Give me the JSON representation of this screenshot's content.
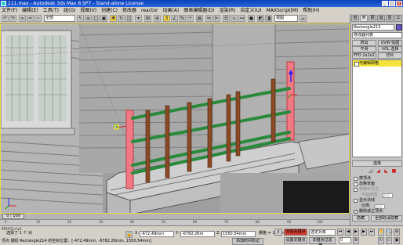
{
  "window": {
    "title": "111.max - Autodesk 3ds Max 8 SP7  -  Stand-alone License",
    "buttons": [
      "_",
      "□",
      "×"
    ]
  },
  "menu": [
    "文件(F)",
    "编辑(E)",
    "工具(T)",
    "组(G)",
    "视图(V)",
    "创建(C)",
    "修改器",
    "reactor",
    "动画(A)",
    "图表编辑器(D)",
    "渲染(R)",
    "自定义(U)",
    "MAXScript(M)",
    "帮助(H)"
  ],
  "toolbar": {
    "filter_select": "全部",
    "view_select": "视图"
  },
  "command_panel": {
    "tabs": [
      "创",
      "修",
      "层",
      "运",
      "显",
      "工"
    ],
    "object_name": "Rectangle213",
    "modifier_list": "修改器列表",
    "buttons_row1": [
      "挤出",
      "UVW 贴图"
    ],
    "buttons_row2": [
      "平滑",
      "VOL 选择"
    ],
    "buttons_row3": [
      "FFD 2x2x2",
      "切片"
    ],
    "stack_item": "可编辑网格",
    "rollout_title": "选择",
    "options": [
      {
        "label": "按顶点",
        "checked": false,
        "dim": false
      },
      {
        "label": "忽略背面",
        "checked": false,
        "dim": false
      },
      {
        "label": "忽略可见边",
        "checked": false,
        "dim": true
      },
      {
        "label": "平面阈值:",
        "checked": false,
        "dim": true,
        "value": "45.0"
      },
      {
        "label": "显示法线",
        "checked": false,
        "dim": false
      },
      {
        "label": "比例:",
        "checked": false,
        "dim": false,
        "value": "20.0"
      },
      {
        "label": "删除孤立顶点",
        "checked": true,
        "dim": false
      }
    ],
    "hide_buttons": [
      "隐藏",
      "全部取消隐藏"
    ],
    "named_selection": "命名选择:",
    "copy_paste": [
      "复制",
      "粘贴"
    ],
    "status": "选择了 24 个面"
  },
  "timeline": {
    "slider_label": "0 / 100",
    "tick_labels": [
      "0",
      "10",
      "20",
      "30",
      "40",
      "50",
      "60",
      "70",
      "80",
      "90",
      "100"
    ]
  },
  "status": {
    "selected": "选择了 1 个 对",
    "x_label": "X:",
    "x_value": "-672.49mm",
    "y_label": "Y:",
    "y_value": "-6782.26m",
    "z_label": "Z:",
    "z_value": "1550.54mm",
    "grid": "栅格 = 10.0mm",
    "autokey": "自动关键点",
    "selected_obj": "选定对象",
    "set_key": "设置关键点",
    "key_filters": "关键点过滤器...",
    "frame": "0",
    "prompt": "顶点 捕捉 Rectangle214 的坐标位置：[-472.49mm, -6782.26mm, 1550.54mm]",
    "add_time_tag": "添加时间标记",
    "script_label": "MAXScript"
  }
}
